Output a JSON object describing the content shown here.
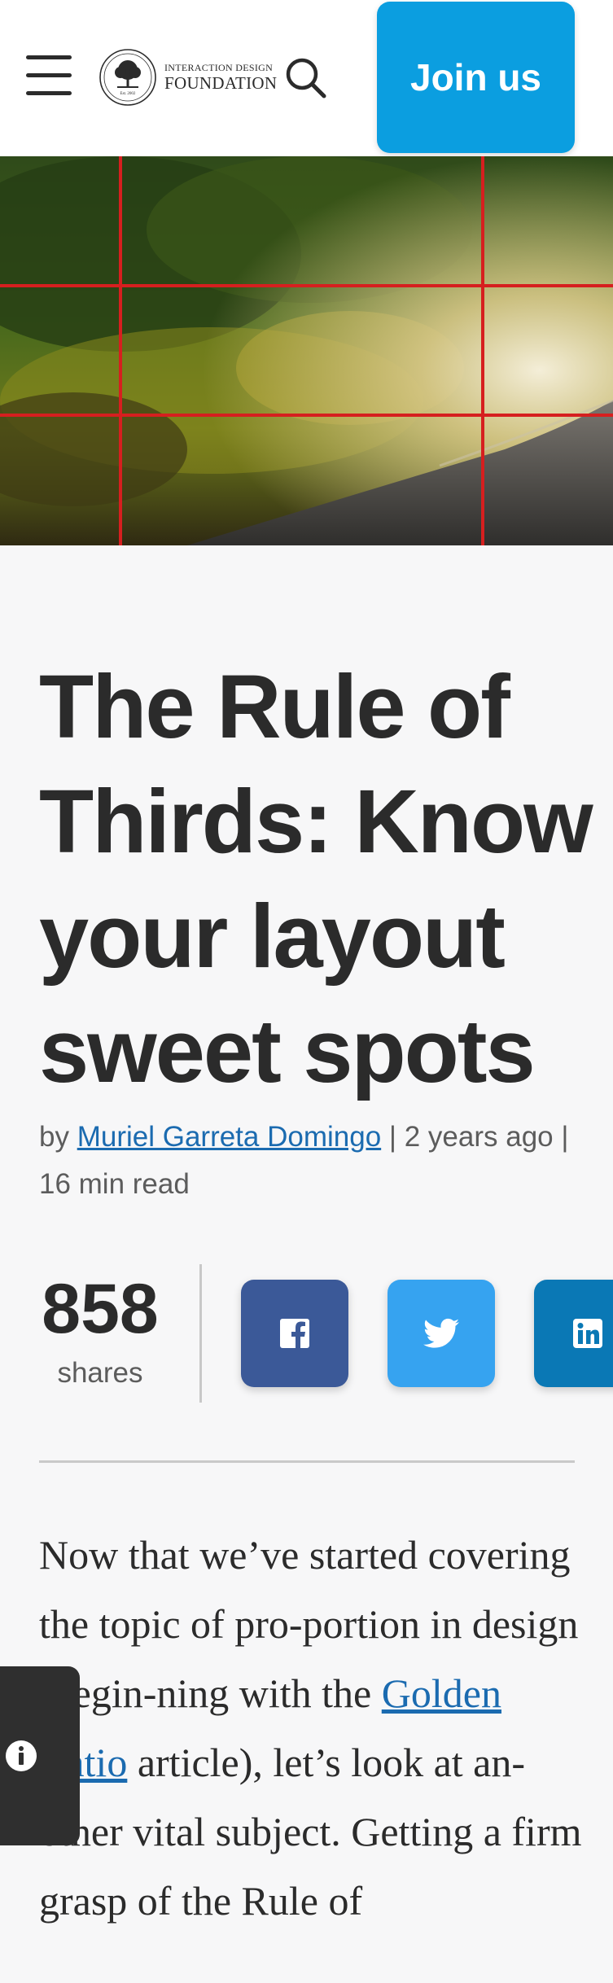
{
  "header": {
    "logo_line1": "INTERACTION DESIGN",
    "logo_line2": "FOUNDATION",
    "logo_est": "Est. 2002",
    "join_label": "Join us"
  },
  "article": {
    "title": "The Rule of Thirds: Know your layout sweet spots",
    "meta_by": "by",
    "author": "Muriel Garreta Domingo",
    "meta_sep1": "|",
    "age": "2 years ago",
    "meta_sep2": "|",
    "read_time": "16 min read",
    "shares_count": "858",
    "shares_label": "shares",
    "body_before": "Now that we’ve started covering the topic of pro-portion in design (begin-ning with the",
    "body_link": "Golden Ratio",
    "body_after": "article), let’s look at an-other vital subject. Getting a firm grasp of the Rule of"
  },
  "icons": {
    "menu": "hamburger-icon",
    "search": "search-icon",
    "facebook": "facebook-icon",
    "twitter": "twitter-icon",
    "linkedin": "linkedin-icon",
    "info": "info-icon"
  },
  "colors": {
    "accent": "#0b9ee0",
    "facebook": "#3b5998",
    "twitter": "#36a3f0",
    "linkedin": "#0a78b5",
    "link": "#1b6bb0",
    "grid_lines": "#d61f1f"
  }
}
